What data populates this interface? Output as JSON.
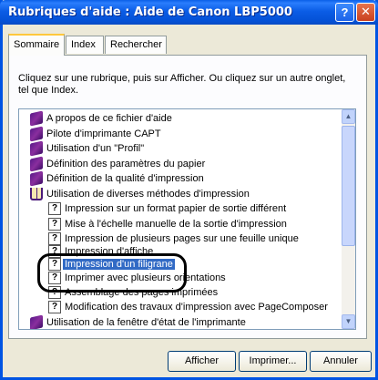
{
  "window": {
    "title": "Rubriques d'aide : Aide de Canon LBP5000",
    "help_btn": "?",
    "close_btn": "✕"
  },
  "tabs": [
    {
      "label": "Sommaire",
      "active": true
    },
    {
      "label": "Index",
      "active": false
    },
    {
      "label": "Rechercher",
      "active": false
    }
  ],
  "instructions": "Cliquez sur une rubrique, puis sur Afficher. Ou cliquez sur un autre onglet, tel que Index.",
  "tree": {
    "items": [
      {
        "label": "A propos de ce fichier d'aide",
        "icon": "book-icon"
      },
      {
        "label": "Pilote d'imprimante CAPT",
        "icon": "book-icon"
      },
      {
        "label": "Utilisation d'un \"Profil\"",
        "icon": "book-icon"
      },
      {
        "label": "Définition des paramètres du papier",
        "icon": "book-icon"
      },
      {
        "label": "Définition de la qualité d'impression",
        "icon": "book-icon"
      },
      {
        "label": "Utilisation de diverses méthodes d'impression",
        "icon": "open-book-icon"
      },
      {
        "label": "Impression sur un format papier de sortie différent",
        "icon": "help-page-icon"
      },
      {
        "label": "Mise à l'échelle manuelle de la sortie d'impression",
        "icon": "help-page-icon"
      },
      {
        "label": "Impression de plusieurs pages sur une feuille unique",
        "icon": "help-page-icon"
      },
      {
        "label": "Impression d'affiche",
        "icon": "help-page-icon"
      },
      {
        "label": "Impression d'un filigrane",
        "icon": "help-page-icon",
        "selected": true
      },
      {
        "label": "Imprimer avec plusieurs orientations",
        "icon": "help-page-icon"
      },
      {
        "label": "Assemblage des pages imprimées",
        "icon": "help-page-icon"
      },
      {
        "label": "Modification des travaux d'impression avec PageComposer",
        "icon": "help-page-icon"
      },
      {
        "label": "Utilisation de la fenêtre d'état de l'imprimante",
        "icon": "book-icon"
      }
    ]
  },
  "buttons": {
    "afficher": "Afficher",
    "imprimer": "Imprimer...",
    "annuler": "Annuler"
  },
  "colors": {
    "titlebar": "#0a5fe8",
    "selection": "#316ac5",
    "dialog_bg": "#ece9d8"
  }
}
